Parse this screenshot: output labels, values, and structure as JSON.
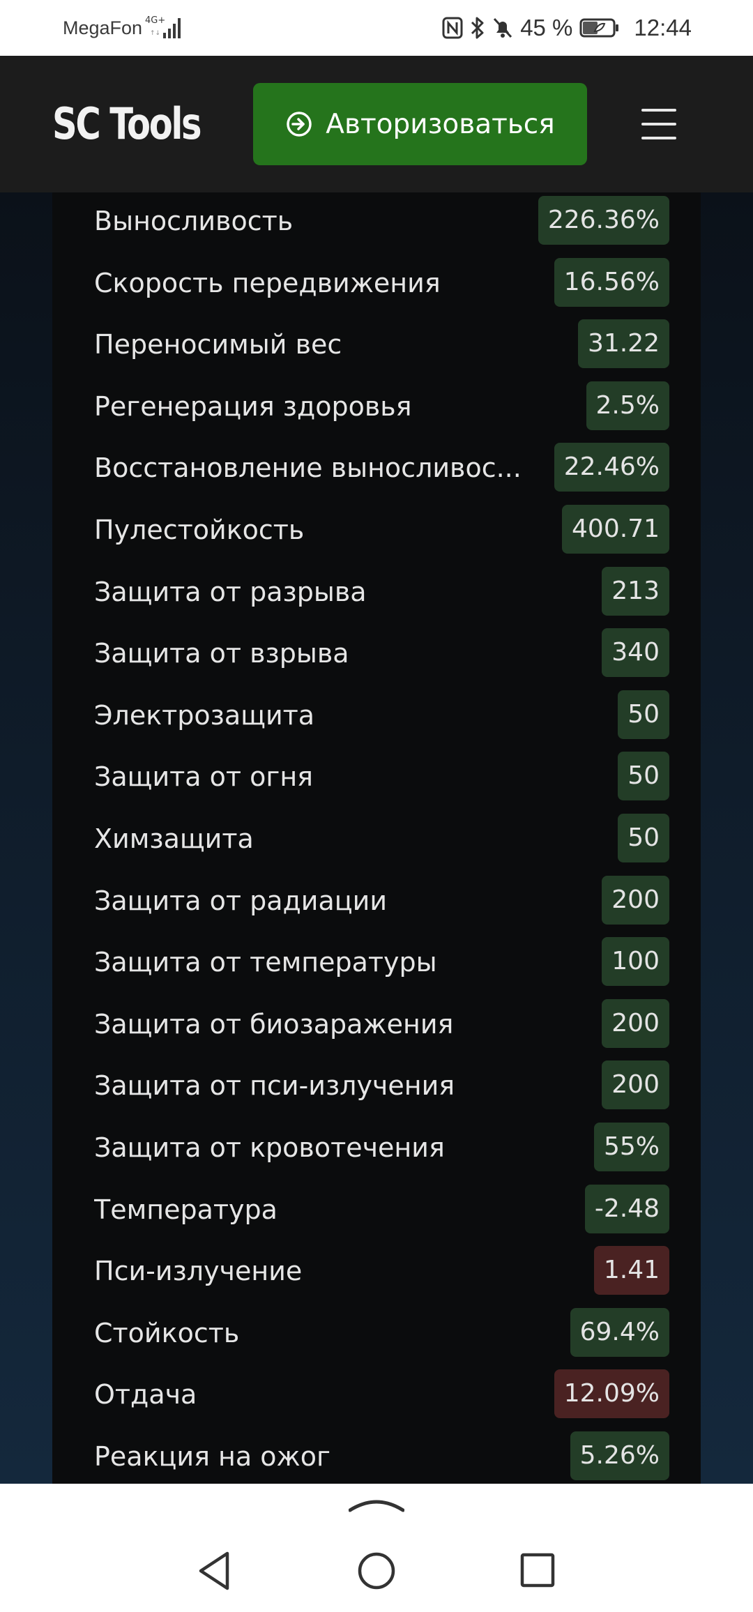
{
  "status_bar": {
    "carrier": "MegaFon",
    "network": "4G+",
    "battery": "45 %",
    "time": "12:44"
  },
  "header": {
    "brand": "SC Tools",
    "login_label": "Авторизоваться",
    "menu_icon": "hamburger-menu-icon"
  },
  "colors": {
    "header_bg": "#1c1c1c",
    "login_button": "#25741c",
    "positive_badge": "#233d27",
    "negative_badge": "#4a2222"
  },
  "stats": [
    {
      "label": "Выносливость",
      "value": "226.36%",
      "tone": "pos"
    },
    {
      "label": "Скорость передвижения",
      "value": "16.56%",
      "tone": "pos"
    },
    {
      "label": "Переносимый вес",
      "value": "31.22",
      "tone": "pos"
    },
    {
      "label": "Регенерация здоровья",
      "value": "2.5%",
      "tone": "pos"
    },
    {
      "label": "Восстановление выносливос...",
      "value": "22.46%",
      "tone": "pos"
    },
    {
      "label": "Пулестойкость",
      "value": "400.71",
      "tone": "pos"
    },
    {
      "label": "Защита от разрыва",
      "value": "213",
      "tone": "pos"
    },
    {
      "label": "Защита от взрыва",
      "value": "340",
      "tone": "pos"
    },
    {
      "label": "Электрозащита",
      "value": "50",
      "tone": "pos"
    },
    {
      "label": "Защита от огня",
      "value": "50",
      "tone": "pos"
    },
    {
      "label": "Химзащита",
      "value": "50",
      "tone": "pos"
    },
    {
      "label": "Защита от радиации",
      "value": "200",
      "tone": "pos"
    },
    {
      "label": "Защита от температуры",
      "value": "100",
      "tone": "pos"
    },
    {
      "label": "Защита от биозаражения",
      "value": "200",
      "tone": "pos"
    },
    {
      "label": "Защита от пси-излучения",
      "value": "200",
      "tone": "pos"
    },
    {
      "label": "Защита от кровотечения",
      "value": "55%",
      "tone": "pos"
    },
    {
      "label": "Температура",
      "value": "-2.48",
      "tone": "pos"
    },
    {
      "label": "Пси-излучение",
      "value": "1.41",
      "tone": "neg"
    },
    {
      "label": "Стойкость",
      "value": "69.4%",
      "tone": "pos"
    },
    {
      "label": "Отдача",
      "value": "12.09%",
      "tone": "neg"
    },
    {
      "label": "Реакция на ожог",
      "value": "5.26%",
      "tone": "pos"
    }
  ],
  "nav": {
    "back_icon": "back-triangle-icon",
    "home_icon": "home-circle-icon",
    "recents_icon": "recents-square-icon",
    "handle_icon": "chevron-up-icon"
  }
}
